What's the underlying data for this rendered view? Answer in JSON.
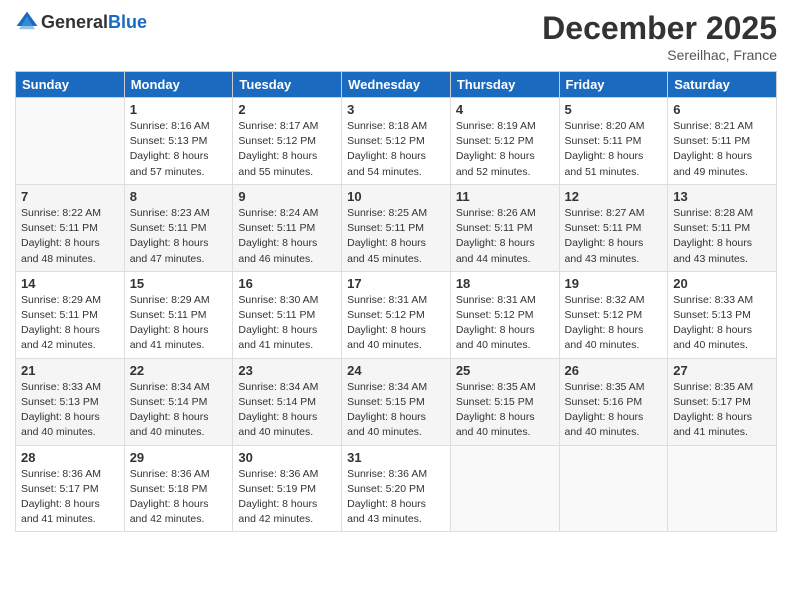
{
  "header": {
    "logo_general": "General",
    "logo_blue": "Blue",
    "month_title": "December 2025",
    "location": "Sereilhac, France"
  },
  "weekdays": [
    "Sunday",
    "Monday",
    "Tuesday",
    "Wednesday",
    "Thursday",
    "Friday",
    "Saturday"
  ],
  "weeks": [
    [
      {
        "day": "",
        "sunrise": "",
        "sunset": "",
        "daylight": "",
        "empty": true
      },
      {
        "day": "1",
        "sunrise": "Sunrise: 8:16 AM",
        "sunset": "Sunset: 5:13 PM",
        "daylight": "Daylight: 8 hours and 57 minutes."
      },
      {
        "day": "2",
        "sunrise": "Sunrise: 8:17 AM",
        "sunset": "Sunset: 5:12 PM",
        "daylight": "Daylight: 8 hours and 55 minutes."
      },
      {
        "day": "3",
        "sunrise": "Sunrise: 8:18 AM",
        "sunset": "Sunset: 5:12 PM",
        "daylight": "Daylight: 8 hours and 54 minutes."
      },
      {
        "day": "4",
        "sunrise": "Sunrise: 8:19 AM",
        "sunset": "Sunset: 5:12 PM",
        "daylight": "Daylight: 8 hours and 52 minutes."
      },
      {
        "day": "5",
        "sunrise": "Sunrise: 8:20 AM",
        "sunset": "Sunset: 5:11 PM",
        "daylight": "Daylight: 8 hours and 51 minutes."
      },
      {
        "day": "6",
        "sunrise": "Sunrise: 8:21 AM",
        "sunset": "Sunset: 5:11 PM",
        "daylight": "Daylight: 8 hours and 49 minutes."
      }
    ],
    [
      {
        "day": "7",
        "sunrise": "Sunrise: 8:22 AM",
        "sunset": "Sunset: 5:11 PM",
        "daylight": "Daylight: 8 hours and 48 minutes."
      },
      {
        "day": "8",
        "sunrise": "Sunrise: 8:23 AM",
        "sunset": "Sunset: 5:11 PM",
        "daylight": "Daylight: 8 hours and 47 minutes."
      },
      {
        "day": "9",
        "sunrise": "Sunrise: 8:24 AM",
        "sunset": "Sunset: 5:11 PM",
        "daylight": "Daylight: 8 hours and 46 minutes."
      },
      {
        "day": "10",
        "sunrise": "Sunrise: 8:25 AM",
        "sunset": "Sunset: 5:11 PM",
        "daylight": "Daylight: 8 hours and 45 minutes."
      },
      {
        "day": "11",
        "sunrise": "Sunrise: 8:26 AM",
        "sunset": "Sunset: 5:11 PM",
        "daylight": "Daylight: 8 hours and 44 minutes."
      },
      {
        "day": "12",
        "sunrise": "Sunrise: 8:27 AM",
        "sunset": "Sunset: 5:11 PM",
        "daylight": "Daylight: 8 hours and 43 minutes."
      },
      {
        "day": "13",
        "sunrise": "Sunrise: 8:28 AM",
        "sunset": "Sunset: 5:11 PM",
        "daylight": "Daylight: 8 hours and 43 minutes."
      }
    ],
    [
      {
        "day": "14",
        "sunrise": "Sunrise: 8:29 AM",
        "sunset": "Sunset: 5:11 PM",
        "daylight": "Daylight: 8 hours and 42 minutes."
      },
      {
        "day": "15",
        "sunrise": "Sunrise: 8:29 AM",
        "sunset": "Sunset: 5:11 PM",
        "daylight": "Daylight: 8 hours and 41 minutes."
      },
      {
        "day": "16",
        "sunrise": "Sunrise: 8:30 AM",
        "sunset": "Sunset: 5:11 PM",
        "daylight": "Daylight: 8 hours and 41 minutes."
      },
      {
        "day": "17",
        "sunrise": "Sunrise: 8:31 AM",
        "sunset": "Sunset: 5:12 PM",
        "daylight": "Daylight: 8 hours and 40 minutes."
      },
      {
        "day": "18",
        "sunrise": "Sunrise: 8:31 AM",
        "sunset": "Sunset: 5:12 PM",
        "daylight": "Daylight: 8 hours and 40 minutes."
      },
      {
        "day": "19",
        "sunrise": "Sunrise: 8:32 AM",
        "sunset": "Sunset: 5:12 PM",
        "daylight": "Daylight: 8 hours and 40 minutes."
      },
      {
        "day": "20",
        "sunrise": "Sunrise: 8:33 AM",
        "sunset": "Sunset: 5:13 PM",
        "daylight": "Daylight: 8 hours and 40 minutes."
      }
    ],
    [
      {
        "day": "21",
        "sunrise": "Sunrise: 8:33 AM",
        "sunset": "Sunset: 5:13 PM",
        "daylight": "Daylight: 8 hours and 40 minutes."
      },
      {
        "day": "22",
        "sunrise": "Sunrise: 8:34 AM",
        "sunset": "Sunset: 5:14 PM",
        "daylight": "Daylight: 8 hours and 40 minutes."
      },
      {
        "day": "23",
        "sunrise": "Sunrise: 8:34 AM",
        "sunset": "Sunset: 5:14 PM",
        "daylight": "Daylight: 8 hours and 40 minutes."
      },
      {
        "day": "24",
        "sunrise": "Sunrise: 8:34 AM",
        "sunset": "Sunset: 5:15 PM",
        "daylight": "Daylight: 8 hours and 40 minutes."
      },
      {
        "day": "25",
        "sunrise": "Sunrise: 8:35 AM",
        "sunset": "Sunset: 5:15 PM",
        "daylight": "Daylight: 8 hours and 40 minutes."
      },
      {
        "day": "26",
        "sunrise": "Sunrise: 8:35 AM",
        "sunset": "Sunset: 5:16 PM",
        "daylight": "Daylight: 8 hours and 40 minutes."
      },
      {
        "day": "27",
        "sunrise": "Sunrise: 8:35 AM",
        "sunset": "Sunset: 5:17 PM",
        "daylight": "Daylight: 8 hours and 41 minutes."
      }
    ],
    [
      {
        "day": "28",
        "sunrise": "Sunrise: 8:36 AM",
        "sunset": "Sunset: 5:17 PM",
        "daylight": "Daylight: 8 hours and 41 minutes."
      },
      {
        "day": "29",
        "sunrise": "Sunrise: 8:36 AM",
        "sunset": "Sunset: 5:18 PM",
        "daylight": "Daylight: 8 hours and 42 minutes."
      },
      {
        "day": "30",
        "sunrise": "Sunrise: 8:36 AM",
        "sunset": "Sunset: 5:19 PM",
        "daylight": "Daylight: 8 hours and 42 minutes."
      },
      {
        "day": "31",
        "sunrise": "Sunrise: 8:36 AM",
        "sunset": "Sunset: 5:20 PM",
        "daylight": "Daylight: 8 hours and 43 minutes."
      },
      {
        "day": "",
        "sunrise": "",
        "sunset": "",
        "daylight": "",
        "empty": true
      },
      {
        "day": "",
        "sunrise": "",
        "sunset": "",
        "daylight": "",
        "empty": true
      },
      {
        "day": "",
        "sunrise": "",
        "sunset": "",
        "daylight": "",
        "empty": true
      }
    ]
  ]
}
